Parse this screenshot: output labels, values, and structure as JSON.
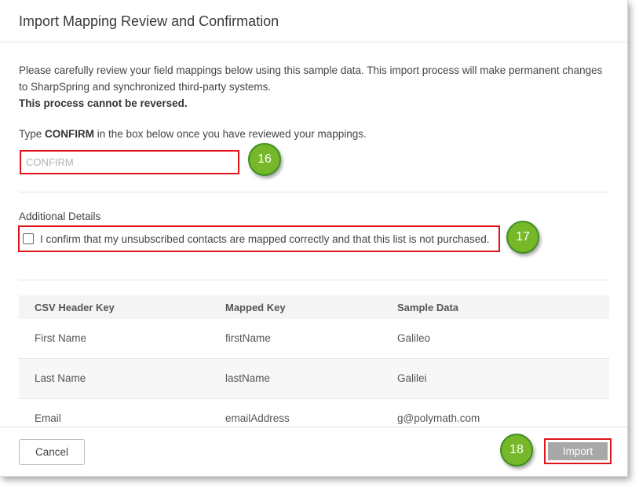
{
  "dialog": {
    "title": "Import Mapping Review and Confirmation"
  },
  "description": {
    "line1": "Please carefully review your field mappings below using this sample data. This import process will make permanent changes",
    "line2": "to SharpSpring and synchronized third-party systems.",
    "warning": "This process cannot be reversed."
  },
  "confirm_instruction": {
    "prefix": "Type ",
    "keyword": "CONFIRM",
    "suffix": " in the box below once you have reviewed your mappings."
  },
  "confirm_input": {
    "placeholder": "CONFIRM",
    "value": ""
  },
  "additional_details": {
    "heading": "Additional Details",
    "checkbox_label": "I confirm that my unsubscribed contacts are mapped correctly and that this list is not purchased.",
    "checked": false
  },
  "table": {
    "headers": [
      "CSV Header Key",
      "Mapped Key",
      "Sample Data"
    ],
    "rows": [
      [
        "First Name",
        "firstName",
        "Galileo"
      ],
      [
        "Last Name",
        "lastName",
        "Galilei"
      ],
      [
        "Email",
        "emailAddress",
        "g@polymath.com"
      ]
    ]
  },
  "footer": {
    "cancel_label": "Cancel",
    "import_label": "Import"
  },
  "callouts": {
    "confirm_step": "16",
    "checkbox_step": "17",
    "import_step": "18"
  },
  "colors": {
    "highlight_border": "#e0141b",
    "callout_fill": "#76b82a",
    "import_button": "#a8a8a8"
  }
}
